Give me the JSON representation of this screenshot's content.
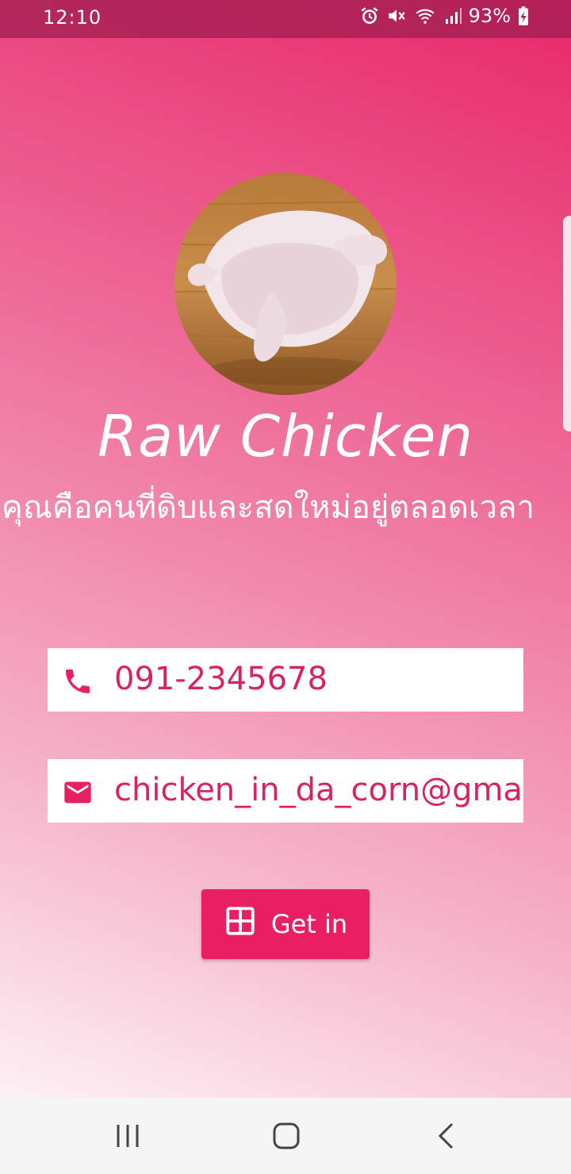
{
  "status_bar": {
    "time": "12:10",
    "battery": "93%",
    "icons": [
      "alarm-icon",
      "mute-icon",
      "wifi-icon",
      "signal-icon",
      "battery-charging-icon"
    ]
  },
  "profile": {
    "avatar_alt": "raw-chicken-photo",
    "title": "Raw Chicken",
    "tagline": "คุณคือคนที่ดิบและสดใหม่อยู่ตลอดเวลา"
  },
  "contact": {
    "phone": "091-2345678",
    "email": "chicken_in_da_corn@gmail.com"
  },
  "action": {
    "get_in_label": "Get in",
    "icon": "grid-icon"
  },
  "colors": {
    "accent": "#e91e63",
    "text_accent": "#d8235f"
  }
}
